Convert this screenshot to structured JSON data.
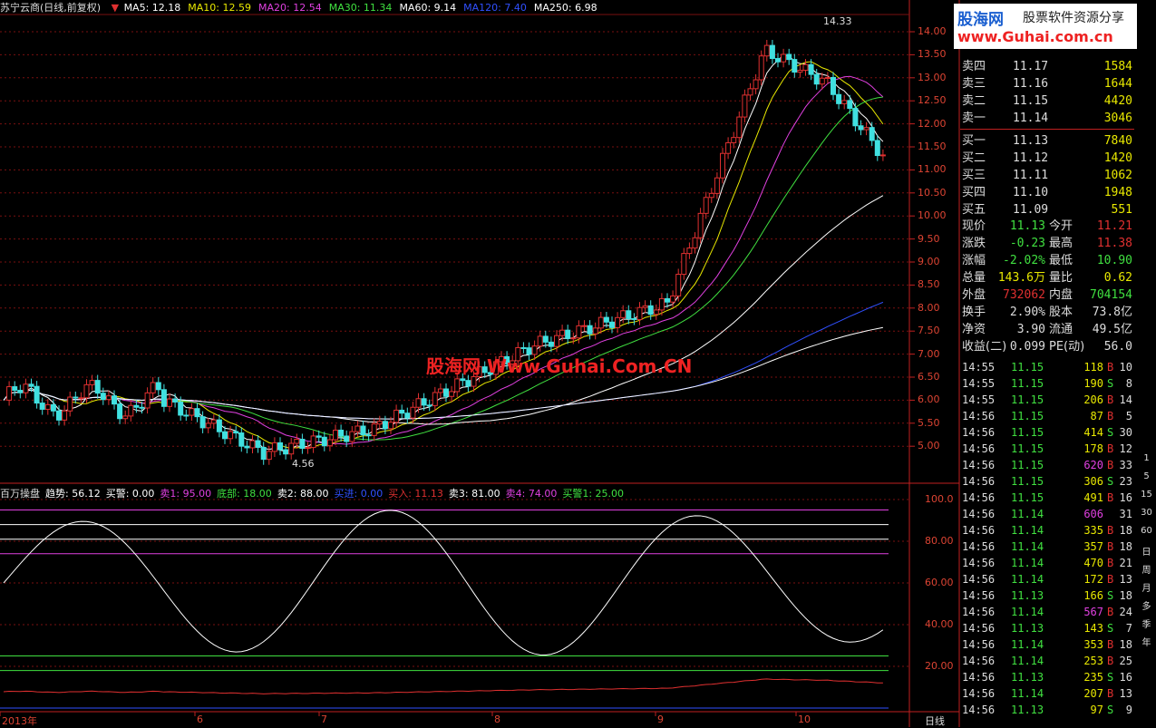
{
  "chart_title": "苏宁云商(日线,前复权)",
  "ma_legend": [
    {
      "label": "MA5: 12.18",
      "color": "#ffffff"
    },
    {
      "label": "MA10: 12.59",
      "color": "#e8e800"
    },
    {
      "label": "MA20: 12.54",
      "color": "#e040e0"
    },
    {
      "label": "MA30: 11.34",
      "color": "#40e040"
    },
    {
      "label": "MA60: 9.14",
      "color": "#ffffff"
    },
    {
      "label": "MA120: 7.40",
      "color": "#3050ff"
    },
    {
      "label": "MA250: 6.98",
      "color": "#ffffff"
    }
  ],
  "price_axis": [
    "14.00",
    "13.50",
    "13.00",
    "12.50",
    "12.00",
    "11.50",
    "11.00",
    "10.50",
    "10.00",
    "9.50",
    "9.00",
    "8.50",
    "8.00",
    "7.50",
    "7.00",
    "6.50",
    "6.00",
    "5.50",
    "5.00"
  ],
  "high_label": "14.33",
  "low_label": "4.56",
  "indicator_legend": [
    {
      "label": "百万操盘",
      "color": "#dddddd"
    },
    {
      "label": "趋势: 56.12",
      "color": "#ffffff"
    },
    {
      "label": "买警: 0.00",
      "color": "#ffffff"
    },
    {
      "label": "卖1: 95.00",
      "color": "#e040e0"
    },
    {
      "label": "底部: 18.00",
      "color": "#40e040"
    },
    {
      "label": "卖2: 88.00",
      "color": "#ffffff"
    },
    {
      "label": "买进: 0.00",
      "color": "#3050ff"
    },
    {
      "label": "买入: 11.13",
      "color": "#e03030"
    },
    {
      "label": "卖3: 81.00",
      "color": "#ffffff"
    },
    {
      "label": "卖4: 74.00",
      "color": "#e040e0"
    },
    {
      "label": "买警1: 25.00",
      "color": "#40e040"
    }
  ],
  "indicator_axis": [
    "100.0",
    "80.00",
    "60.00",
    "40.00",
    "20.00"
  ],
  "x_axis": [
    "2013年",
    "6",
    "7",
    "8",
    "9",
    "10",
    "日线"
  ],
  "watermark": "股海网 Www.Guhai.Com.CN",
  "logo": {
    "brand": "股海网",
    "slogan": "股票软件资源分享",
    "url": "www.Guhai.com.cn"
  },
  "order_book": {
    "asks": [
      {
        "label": "卖四",
        "price": "11.17",
        "vol": "1584"
      },
      {
        "label": "卖三",
        "price": "11.16",
        "vol": "1644"
      },
      {
        "label": "卖二",
        "price": "11.15",
        "vol": "4420"
      },
      {
        "label": "卖一",
        "price": "11.14",
        "vol": "3046"
      }
    ],
    "bids": [
      {
        "label": "买一",
        "price": "11.13",
        "vol": "7840"
      },
      {
        "label": "买二",
        "price": "11.12",
        "vol": "1420"
      },
      {
        "label": "买三",
        "price": "11.11",
        "vol": "1062"
      },
      {
        "label": "买四",
        "price": "11.10",
        "vol": "1948"
      },
      {
        "label": "买五",
        "price": "11.09",
        "vol": "551"
      }
    ]
  },
  "quote": [
    {
      "l1": "现价",
      "v1": "11.13",
      "c1": "#40e040",
      "l2": "今开",
      "v2": "11.21",
      "c2": "#e03030"
    },
    {
      "l1": "涨跌",
      "v1": "-0.23",
      "c1": "#40e040",
      "l2": "最高",
      "v2": "11.38",
      "c2": "#e03030"
    },
    {
      "l1": "涨幅",
      "v1": "-2.02%",
      "c1": "#40e040",
      "l2": "最低",
      "v2": "10.90",
      "c2": "#40e040"
    },
    {
      "l1": "总量",
      "v1": "143.6万",
      "c1": "#e8e800",
      "l2": "量比",
      "v2": "0.62",
      "c2": "#e8e800"
    },
    {
      "l1": "外盘",
      "v1": "732062",
      "c1": "#e03030",
      "l2": "内盘",
      "v2": "704154",
      "c2": "#40e040"
    },
    {
      "l1": "换手",
      "v1": "2.90%",
      "c1": "#dddddd",
      "l2": "股本",
      "v2": "73.8亿",
      "c2": "#dddddd"
    },
    {
      "l1": "净资",
      "v1": "3.90",
      "c1": "#dddddd",
      "l2": "流通",
      "v2": "49.5亿",
      "c2": "#dddddd"
    },
    {
      "l1": "收益(二)",
      "v1": "0.099",
      "c1": "#dddddd",
      "l2": "PE(动)",
      "v2": "56.0",
      "c2": "#dddddd"
    }
  ],
  "ticks": [
    {
      "t": "14:55",
      "p": "11.15",
      "v": "118",
      "s": "B",
      "n": "10"
    },
    {
      "t": "14:55",
      "p": "11.15",
      "v": "190",
      "s": "S",
      "n": "8"
    },
    {
      "t": "14:55",
      "p": "11.15",
      "v": "206",
      "s": "B",
      "n": "14"
    },
    {
      "t": "14:56",
      "p": "11.15",
      "v": "87",
      "s": "B",
      "n": "5"
    },
    {
      "t": "14:56",
      "p": "11.15",
      "v": "414",
      "s": "S",
      "n": "30"
    },
    {
      "t": "14:56",
      "p": "11.15",
      "v": "178",
      "s": "B",
      "n": "12"
    },
    {
      "t": "14:56",
      "p": "11.15",
      "v": "620",
      "s": "B",
      "n": "33"
    },
    {
      "t": "14:56",
      "p": "11.15",
      "v": "306",
      "s": "S",
      "n": "23"
    },
    {
      "t": "14:56",
      "p": "11.15",
      "v": "491",
      "s": "B",
      "n": "16"
    },
    {
      "t": "14:56",
      "p": "11.14",
      "v": "606",
      "s": "",
      "n": "31"
    },
    {
      "t": "14:56",
      "p": "11.14",
      "v": "335",
      "s": "B",
      "n": "18"
    },
    {
      "t": "14:56",
      "p": "11.14",
      "v": "357",
      "s": "B",
      "n": "18"
    },
    {
      "t": "14:56",
      "p": "11.14",
      "v": "470",
      "s": "B",
      "n": "21"
    },
    {
      "t": "14:56",
      "p": "11.14",
      "v": "172",
      "s": "B",
      "n": "13"
    },
    {
      "t": "14:56",
      "p": "11.13",
      "v": "166",
      "s": "S",
      "n": "18"
    },
    {
      "t": "14:56",
      "p": "11.14",
      "v": "567",
      "s": "B",
      "n": "24"
    },
    {
      "t": "14:56",
      "p": "11.13",
      "v": "143",
      "s": "S",
      "n": "7"
    },
    {
      "t": "14:56",
      "p": "11.14",
      "v": "353",
      "s": "B",
      "n": "18"
    },
    {
      "t": "14:56",
      "p": "11.14",
      "v": "253",
      "s": "B",
      "n": "25"
    },
    {
      "t": "14:56",
      "p": "11.13",
      "v": "235",
      "s": "S",
      "n": "16"
    },
    {
      "t": "14:56",
      "p": "11.14",
      "v": "207",
      "s": "B",
      "n": "13"
    },
    {
      "t": "14:56",
      "p": "11.13",
      "v": "97",
      "s": "S",
      "n": "9"
    }
  ],
  "tools": [
    "1",
    "5",
    "15",
    "30",
    "60",
    "日",
    "周",
    "月",
    "多",
    "季",
    "年"
  ]
}
